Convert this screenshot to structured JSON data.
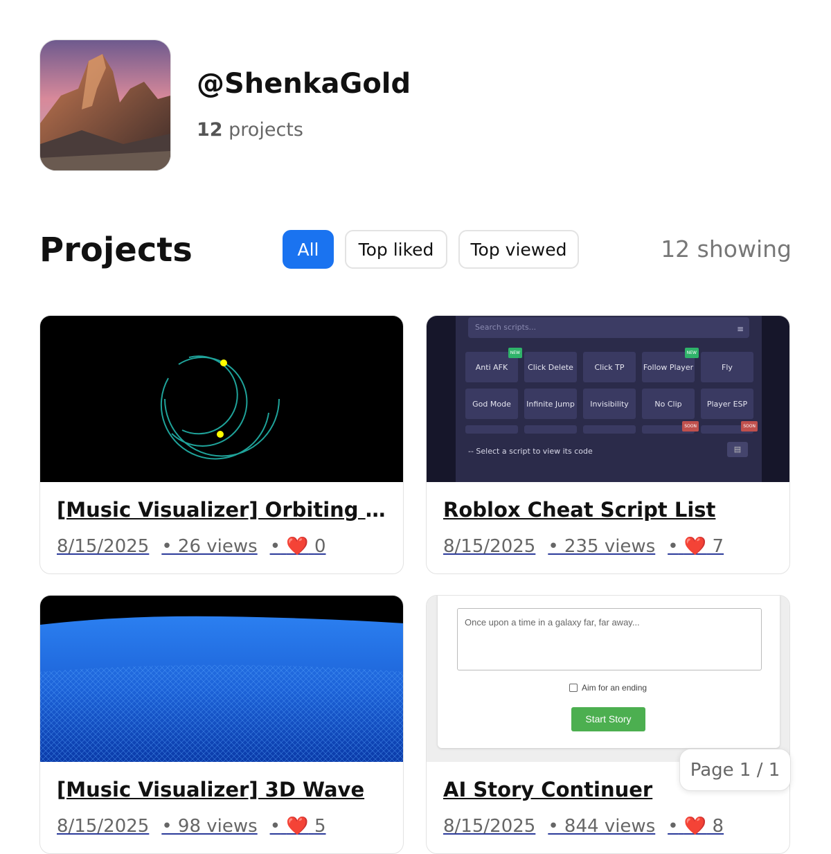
{
  "profile": {
    "handle": "@ShenkaGold",
    "project_count": "12",
    "project_count_suffix": " projects"
  },
  "projects": {
    "title": "Projects",
    "filters": [
      "All",
      "Top liked",
      "Top viewed"
    ],
    "active_filter": "All",
    "showing_text": "12 showing"
  },
  "cards": [
    {
      "title": "[Music Visualizer] Orbiting Circles",
      "date": "8/15/2025",
      "views": "• 26 views",
      "likes_prefix": "•",
      "heart": "❤️",
      "likes": "0"
    },
    {
      "title": "Roblox Cheat Script List",
      "date": "8/15/2025",
      "views": "• 235 views",
      "likes_prefix": "•",
      "heart": "❤️",
      "likes": "7"
    },
    {
      "title": "[Music Visualizer] 3D Wave",
      "date": "8/15/2025",
      "views": "• 98 views",
      "likes_prefix": "•",
      "heart": "❤️",
      "likes": "5"
    },
    {
      "title": "AI Story Continuer",
      "date": "8/15/2025",
      "views": "• 844 views",
      "likes_prefix": "•",
      "heart": "❤️",
      "likes": "8"
    }
  ],
  "script_list_thumb": {
    "search_placeholder": "Search scripts...",
    "buttons": [
      "Anti AFK",
      "Click Delete",
      "Click TP",
      "Follow Player",
      "Fly",
      "God Mode",
      "Infinite Jump",
      "Invisibility",
      "No Clip",
      "Player ESP"
    ],
    "tag_new": "NEW",
    "tag_soon": "SOON",
    "status": "-- Select a script to view its code"
  },
  "story_thumb": {
    "placeholder": "Once upon a time in a galaxy far, far away...",
    "checkbox_label": "Aim for an ending",
    "start_button": "Start Story"
  },
  "pagination": {
    "text": "Page 1 / 1"
  },
  "colors": {
    "accent": "#1a73f0",
    "heart": "#d81d2b",
    "start_green": "#4caf50"
  }
}
